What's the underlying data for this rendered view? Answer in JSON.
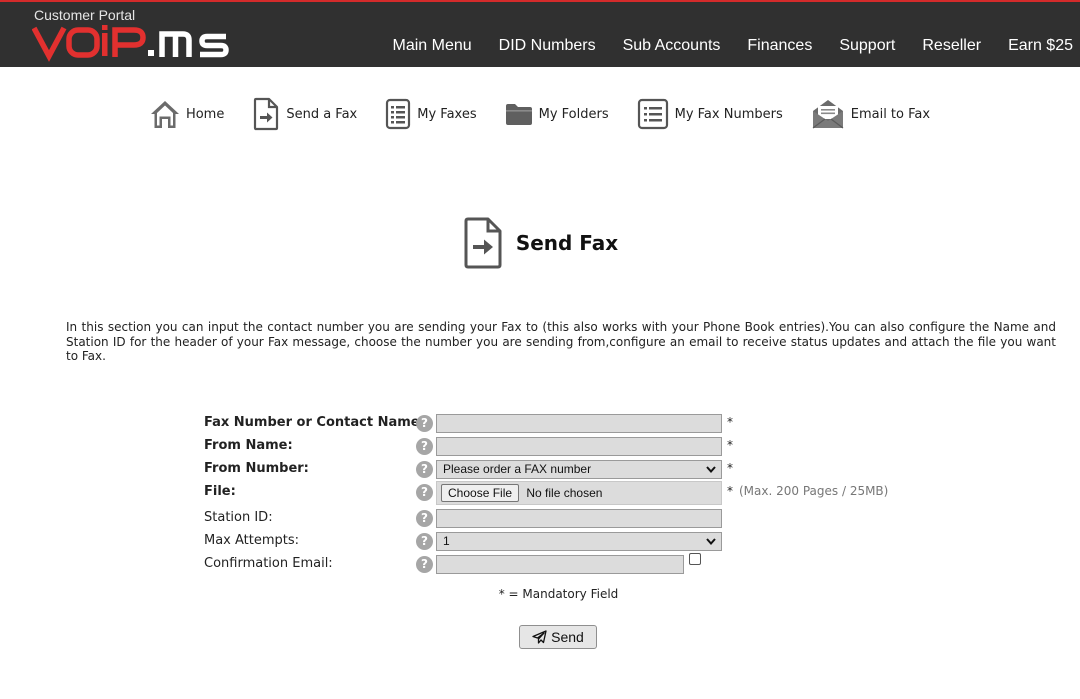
{
  "header": {
    "portal_label": "Customer Portal",
    "logo_text": "VOiP.ms",
    "nav": [
      "Main Menu",
      "DID Numbers",
      "Sub Accounts",
      "Finances",
      "Support",
      "Reseller",
      "Earn $25"
    ]
  },
  "iconbar": [
    {
      "label": "Home",
      "icon": "home-icon"
    },
    {
      "label": "Send a Fax",
      "icon": "send-fax-icon"
    },
    {
      "label": "My Faxes",
      "icon": "list-icon"
    },
    {
      "label": "My Folders",
      "icon": "folder-icon"
    },
    {
      "label": "My Fax Numbers",
      "icon": "list-icon"
    },
    {
      "label": "Email to Fax",
      "icon": "envelope-icon"
    }
  ],
  "page": {
    "title": "Send Fax",
    "description": "In this section you can input the contact number you are sending your Fax to (this also works with your Phone Book entries).You can also configure the Name and Station ID for the header of your Fax message, choose the number you are sending from,configure an email to receive status updates and attach the file you want to Fax."
  },
  "form": {
    "fax_number_label": "Fax Number or Contact Name:",
    "fax_number_value": "",
    "from_name_label": "From Name:",
    "from_name_value": "",
    "from_number_label": "From Number:",
    "from_number_selected": "Please order a FAX number",
    "file_label": "File:",
    "file_button": "Choose File",
    "file_status": "No file chosen",
    "file_hint": "(Max. 200 Pages / 25MB)",
    "station_id_label": "Station ID:",
    "station_id_value": "",
    "max_attempts_label": "Max Attempts:",
    "max_attempts_selected": "1",
    "confirmation_email_label": "Confirmation Email:",
    "confirmation_email_value": "",
    "required_mark": "*",
    "help_glyph": "?",
    "mandatory_note": "* = Mandatory Field",
    "send_label": "Send"
  },
  "colors": {
    "header_bg": "#303030",
    "header_accent": "#d42b2b",
    "logo_red": "#e2302f",
    "field_bg": "#dcdcdc",
    "icon_gray": "#6b6b6b"
  }
}
